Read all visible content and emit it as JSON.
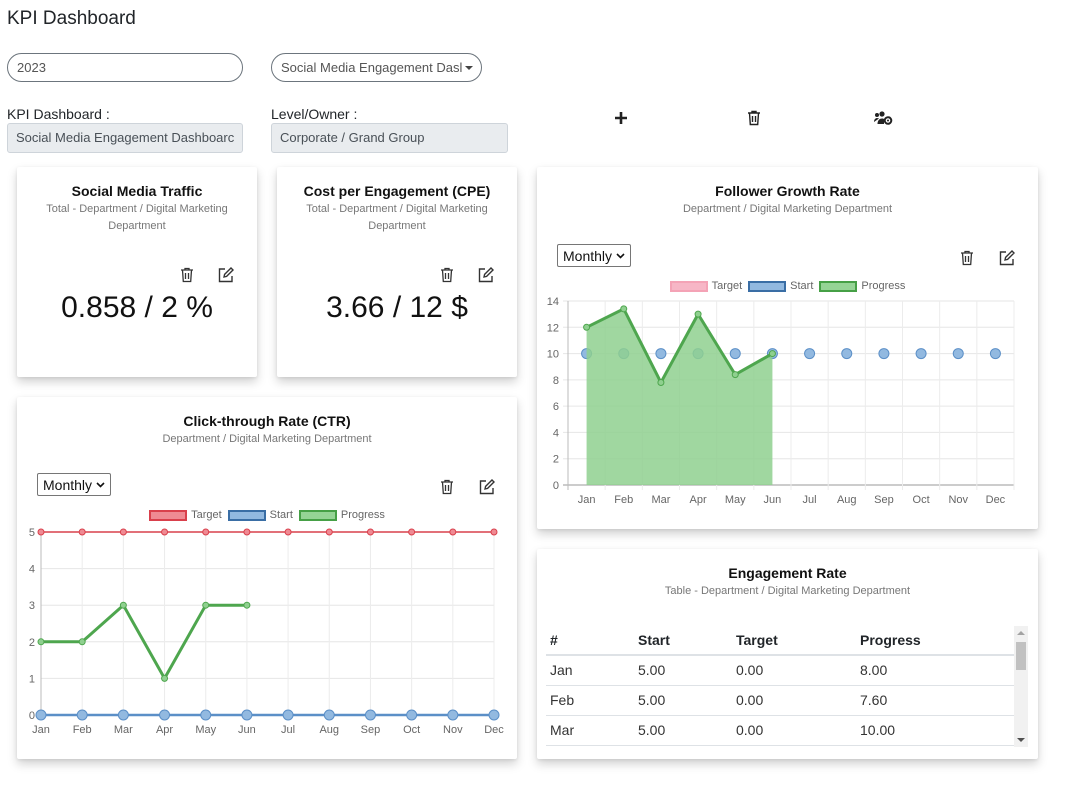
{
  "page": {
    "title": "KPI Dashboard"
  },
  "filters": {
    "year_value": "2023",
    "dashboard_select_value": "Social Media Engagement Dasl"
  },
  "info": {
    "dashboard_label": "KPI Dashboard :",
    "dashboard_value": "Social Media Engagement Dashboarc",
    "owner_label": "Level/Owner :",
    "owner_value": "Corporate / Grand Group"
  },
  "toolbar": {
    "add_icon": "plus-icon",
    "delete_icon": "trash-icon",
    "manage_users_icon": "users-gear-icon"
  },
  "cards": {
    "social_traffic": {
      "title": "Social Media Traffic",
      "subtitle": "Total - Department / Digital Marketing Department",
      "value": "0.858 / 2 %"
    },
    "cpe": {
      "title": "Cost per Engagement (CPE)",
      "subtitle": "Total - Department / Digital Marketing Department",
      "value": "3.66 / 12 $"
    },
    "follower": {
      "title": "Follower Growth Rate",
      "subtitle": "Department / Digital Marketing Department",
      "period": "Monthly"
    },
    "ctr": {
      "title": "Click-through Rate (CTR)",
      "subtitle": "Department / Digital Marketing Department",
      "period": "Monthly"
    },
    "engagement": {
      "title": "Engagement Rate",
      "subtitle": "Table - Department / Digital Marketing Department",
      "columns": [
        "#",
        "Start",
        "Target",
        "Progress"
      ],
      "rows": [
        [
          "Jan",
          "5.00",
          "0.00",
          "8.00"
        ],
        [
          "Feb",
          "5.00",
          "0.00",
          "7.60"
        ],
        [
          "Mar",
          "5.00",
          "0.00",
          "10.00"
        ]
      ]
    }
  },
  "colors": {
    "target_line": "#d9404c",
    "target_fill_pink": "#f7b6c6",
    "start": "#5b8fc7",
    "start_fill": "#92b9e0",
    "progress": "#4ea64e",
    "progress_fill": "#8fd08f"
  },
  "chart_data": [
    {
      "id": "follower",
      "type": "line",
      "title": "Follower Growth Rate",
      "categories": [
        "Jan",
        "Feb",
        "Mar",
        "Apr",
        "May",
        "Jun",
        "Jul",
        "Aug",
        "Sep",
        "Oct",
        "Nov",
        "Dec"
      ],
      "series": [
        {
          "name": "Target",
          "values": []
        },
        {
          "name": "Start",
          "values": [
            10,
            10,
            10,
            10,
            10,
            10,
            10,
            10,
            10,
            10,
            10,
            10
          ]
        },
        {
          "name": "Progress",
          "values": [
            12,
            13.4,
            7.8,
            13,
            8.4,
            10
          ],
          "fill": true
        }
      ],
      "ylim": [
        0,
        14
      ],
      "yticks": [
        0,
        2,
        4,
        6,
        8,
        10,
        12,
        14
      ],
      "legend": "top",
      "grid": true
    },
    {
      "id": "ctr",
      "type": "line",
      "title": "Click-through Rate (CTR)",
      "categories": [
        "Jan",
        "Feb",
        "Mar",
        "Apr",
        "May",
        "Jun",
        "Jul",
        "Aug",
        "Sep",
        "Oct",
        "Nov",
        "Dec"
      ],
      "series": [
        {
          "name": "Target",
          "values": [
            5,
            5,
            5,
            5,
            5,
            5,
            5,
            5,
            5,
            5,
            5,
            5
          ]
        },
        {
          "name": "Start",
          "values": [
            0,
            0,
            0,
            0,
            0,
            0,
            0,
            0,
            0,
            0,
            0,
            0
          ]
        },
        {
          "name": "Progress",
          "values": [
            2,
            2,
            3,
            1,
            3,
            3
          ]
        }
      ],
      "ylim": [
        0,
        5
      ],
      "yticks": [
        0,
        1,
        2,
        3,
        4,
        5
      ],
      "legend": "top",
      "grid": true
    }
  ]
}
